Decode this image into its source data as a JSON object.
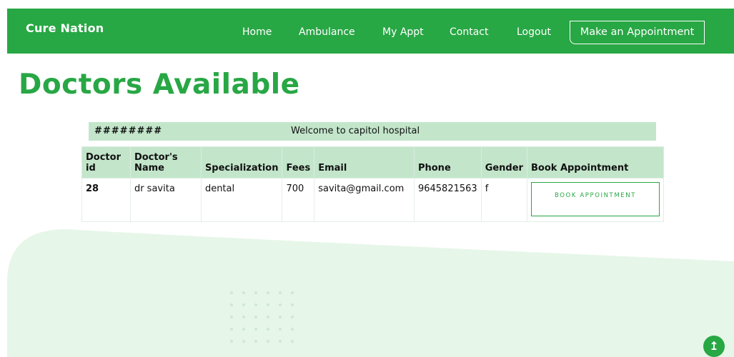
{
  "brand": {
    "name": "Cure Nation"
  },
  "nav": {
    "links": [
      {
        "label": "Home"
      },
      {
        "label": "Ambulance"
      },
      {
        "label": "My Appt"
      },
      {
        "label": "Contact"
      },
      {
        "label": "Logout"
      }
    ],
    "cta_label": "Make an Appointment"
  },
  "page": {
    "title": "Doctors Available"
  },
  "welcome": {
    "hashes": "########",
    "text": "Welcome to capitol hospital"
  },
  "table": {
    "headers": {
      "id": "Doctor id",
      "name": "Doctor's Name",
      "specialization": "Specialization",
      "fees": "Fees",
      "email": "Email",
      "phone": "Phone",
      "gender": "Gender",
      "book": "Book Appointment"
    },
    "rows": [
      {
        "id": "28",
        "name": "dr savita",
        "specialization": "dental",
        "fees": "700",
        "email": "savita@gmail.com",
        "phone": "9645821563",
        "gender": "f",
        "book_label": "BOOK APPOINTMENT"
      }
    ]
  },
  "icons": {
    "scroll_top": "arrow-up-icon"
  },
  "colors": {
    "brand_green": "#28a745",
    "table_header": "#c3e6cb",
    "wave_fill": "#e6f6e8"
  }
}
